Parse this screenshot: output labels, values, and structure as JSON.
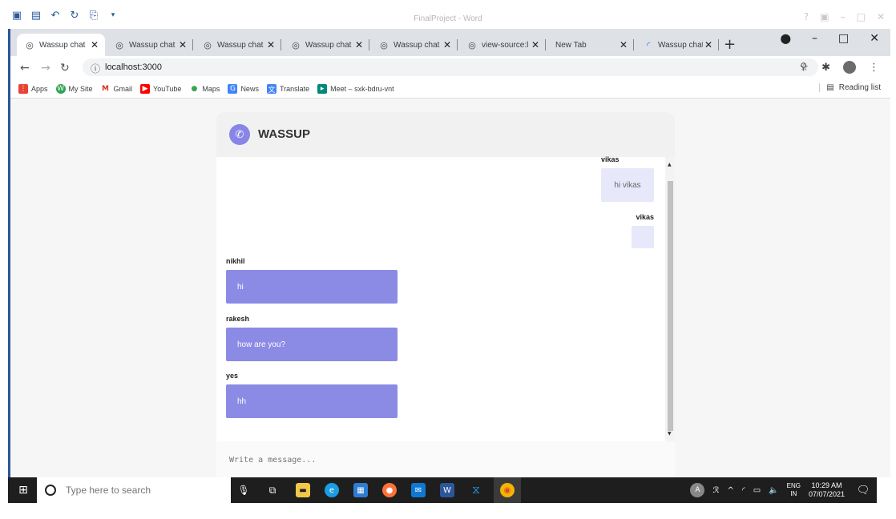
{
  "word": {
    "title": "FinalProject - Word",
    "quick_access_icons": [
      "word-logo-icon",
      "save-icon",
      "undo-icon",
      "redo-icon",
      "paste-icon",
      "more-icon"
    ],
    "controls": [
      "?",
      "▣",
      "–",
      "□",
      "✕"
    ]
  },
  "browser": {
    "tabs": [
      {
        "label": "Wassup chat",
        "icon": "globe-icon",
        "active": true
      },
      {
        "label": "Wassup chat",
        "icon": "globe-icon",
        "active": false
      },
      {
        "label": "Wassup chat",
        "icon": "globe-icon",
        "active": false
      },
      {
        "label": "Wassup chat",
        "icon": "globe-icon",
        "active": false
      },
      {
        "label": "Wassup chat",
        "icon": "globe-icon",
        "active": false
      },
      {
        "label": "view-source:l",
        "icon": "globe-icon",
        "active": false
      },
      {
        "label": "New Tab",
        "icon": "none",
        "active": false
      },
      {
        "label": "Wassup chat",
        "icon": "loading-icon",
        "active": false
      }
    ],
    "close_glyph": "✕",
    "new_tab_glyph": "+",
    "url": "localhost:3000",
    "bookmarks": [
      {
        "label": "Apps",
        "icon": "apps-grid-icon",
        "color": "#e94235"
      },
      {
        "label": "My Site",
        "icon": "wordpress-icon",
        "color": "#2da44e"
      },
      {
        "label": "Gmail",
        "icon": "gmail-icon",
        "color": "#d93025"
      },
      {
        "label": "YouTube",
        "icon": "youtube-icon",
        "color": "#ff0000"
      },
      {
        "label": "Maps",
        "icon": "maps-pin-icon",
        "color": "#34a853"
      },
      {
        "label": "News",
        "icon": "news-icon",
        "color": "#4285f4"
      },
      {
        "label": "Translate",
        "icon": "translate-icon",
        "color": "#4285f4"
      },
      {
        "label": "Meet – sxk-bdru-vnt",
        "icon": "meet-icon",
        "color": "#00897b"
      }
    ],
    "reading_list": "Reading list"
  },
  "chat": {
    "brand": "WASSUP",
    "accent": "#8b8be6",
    "messages": [
      {
        "author": "vikas",
        "text": "hi vikas",
        "side": "out"
      },
      {
        "author": "vikas",
        "text": "",
        "side": "out"
      },
      {
        "author": "nikhil",
        "text": "hi",
        "side": "in"
      },
      {
        "author": "rakesh",
        "text": "how are you?",
        "side": "in"
      },
      {
        "author": "yes",
        "text": "hh",
        "side": "in"
      }
    ],
    "input_placeholder": "Write a message..."
  },
  "taskbar": {
    "search_placeholder": "Type here to search",
    "apps": [
      "task-view-icon",
      "file-explorer-icon",
      "edge-icon",
      "store-icon",
      "firefox-icon",
      "mail-icon",
      "word-icon",
      "vscode-icon",
      "chrome-icon"
    ],
    "tray_user": "A",
    "lang_top": "ENG",
    "lang_bottom": "IN",
    "time": "10:29 AM",
    "date": "07/07/2021"
  }
}
